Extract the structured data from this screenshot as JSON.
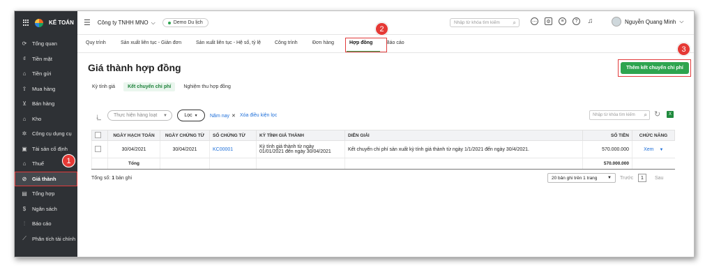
{
  "app": {
    "brand": "KẾ TOÁN"
  },
  "sidebar": {
    "items": [
      {
        "label": "Tổng quan",
        "icon": "⟳"
      },
      {
        "label": "Tiền mặt",
        "icon": "₫"
      },
      {
        "label": "Tiền gửi",
        "icon": "⌂"
      },
      {
        "label": "Mua hàng",
        "icon": "⇧"
      },
      {
        "label": "Bán hàng",
        "icon": "⊻"
      },
      {
        "label": "Kho",
        "icon": "⌂"
      },
      {
        "label": "Công cụ dụng cụ",
        "icon": "✲"
      },
      {
        "label": "Tài sản cố định",
        "icon": "▣"
      },
      {
        "label": "Thuế",
        "icon": "⌂"
      },
      {
        "label": "Giá thành",
        "icon": "⊘"
      },
      {
        "label": "Tổng hợp",
        "icon": "▤"
      },
      {
        "label": "Ngân sách",
        "icon": "$"
      },
      {
        "label": "Báo cáo",
        "icon": "⫶"
      },
      {
        "label": "Phân tích tài chính",
        "icon": "⟋"
      }
    ],
    "active_index": 9
  },
  "topbar": {
    "company": "Công ty TNHH MNO",
    "demo": "Demo Du lịch",
    "search_placeholder": "Nhập từ khóa tìm kiếm",
    "user_name": "Nguyễn Quang Minh"
  },
  "tabs": [
    "Quy trình",
    "Sản xuất liên tục - Giản đơn",
    "Sản xuất liên tục - Hệ số, tỷ lệ",
    "Công trình",
    "Đơn hàng",
    "Hợp đồng",
    "Báo cáo"
  ],
  "active_tab": "Hợp đồng",
  "page": {
    "title": "Giá thành hợp đồng",
    "add_button": "Thêm kết chuyển chi phí"
  },
  "subtabs": [
    "Kỳ tính giá",
    "Kết chuyển chi phí",
    "Nghiệm thu hợp đồng"
  ],
  "toolbar": {
    "bulk_action": "Thực hiện hàng loạt",
    "filter": "Lọc",
    "active_filter": "Năm nay",
    "clear_filter": "Xóa điều kiện lọc",
    "table_search_placeholder": "Nhập từ khóa tìm kiếm"
  },
  "table": {
    "columns": [
      "NGÀY HẠCH TOÁN",
      "NGÀY CHỨNG TỪ",
      "SỐ CHỨNG TỪ",
      "KỲ TÍNH GIÁ THÀNH",
      "DIỄN GIẢI",
      "SỐ TIỀN",
      "CHỨC NĂNG"
    ],
    "rows": [
      {
        "posting_date": "30/04/2021",
        "doc_date": "30/04/2021",
        "doc_no": "KC00001",
        "period_line1": "Kỳ tính giá thành từ ngày",
        "period_line2": "01/01/2021 đến ngày 30/04/2021",
        "description": "Kết chuyển chi phí sản xuất kỳ tính giá thành từ ngày 1/1/2021 đến ngày 30/4/2021.",
        "amount": "570.000.000",
        "action": "Xem"
      }
    ],
    "total_label": "Tổng",
    "total_amount": "570.000.000"
  },
  "footer": {
    "count_prefix": "Tổng số:",
    "count_value": "1",
    "count_suffix": "bản ghi",
    "page_size": "20 bản ghi trên 1 trang",
    "prev": "Trước",
    "page": "1",
    "next": "Sau"
  },
  "annotations": {
    "step1": "1",
    "step2": "2",
    "step3": "3"
  },
  "colors": {
    "accent": "#2ea44f",
    "sidebar": "#2e3135",
    "link": "#1e6fd9",
    "callout": "#e53935"
  }
}
